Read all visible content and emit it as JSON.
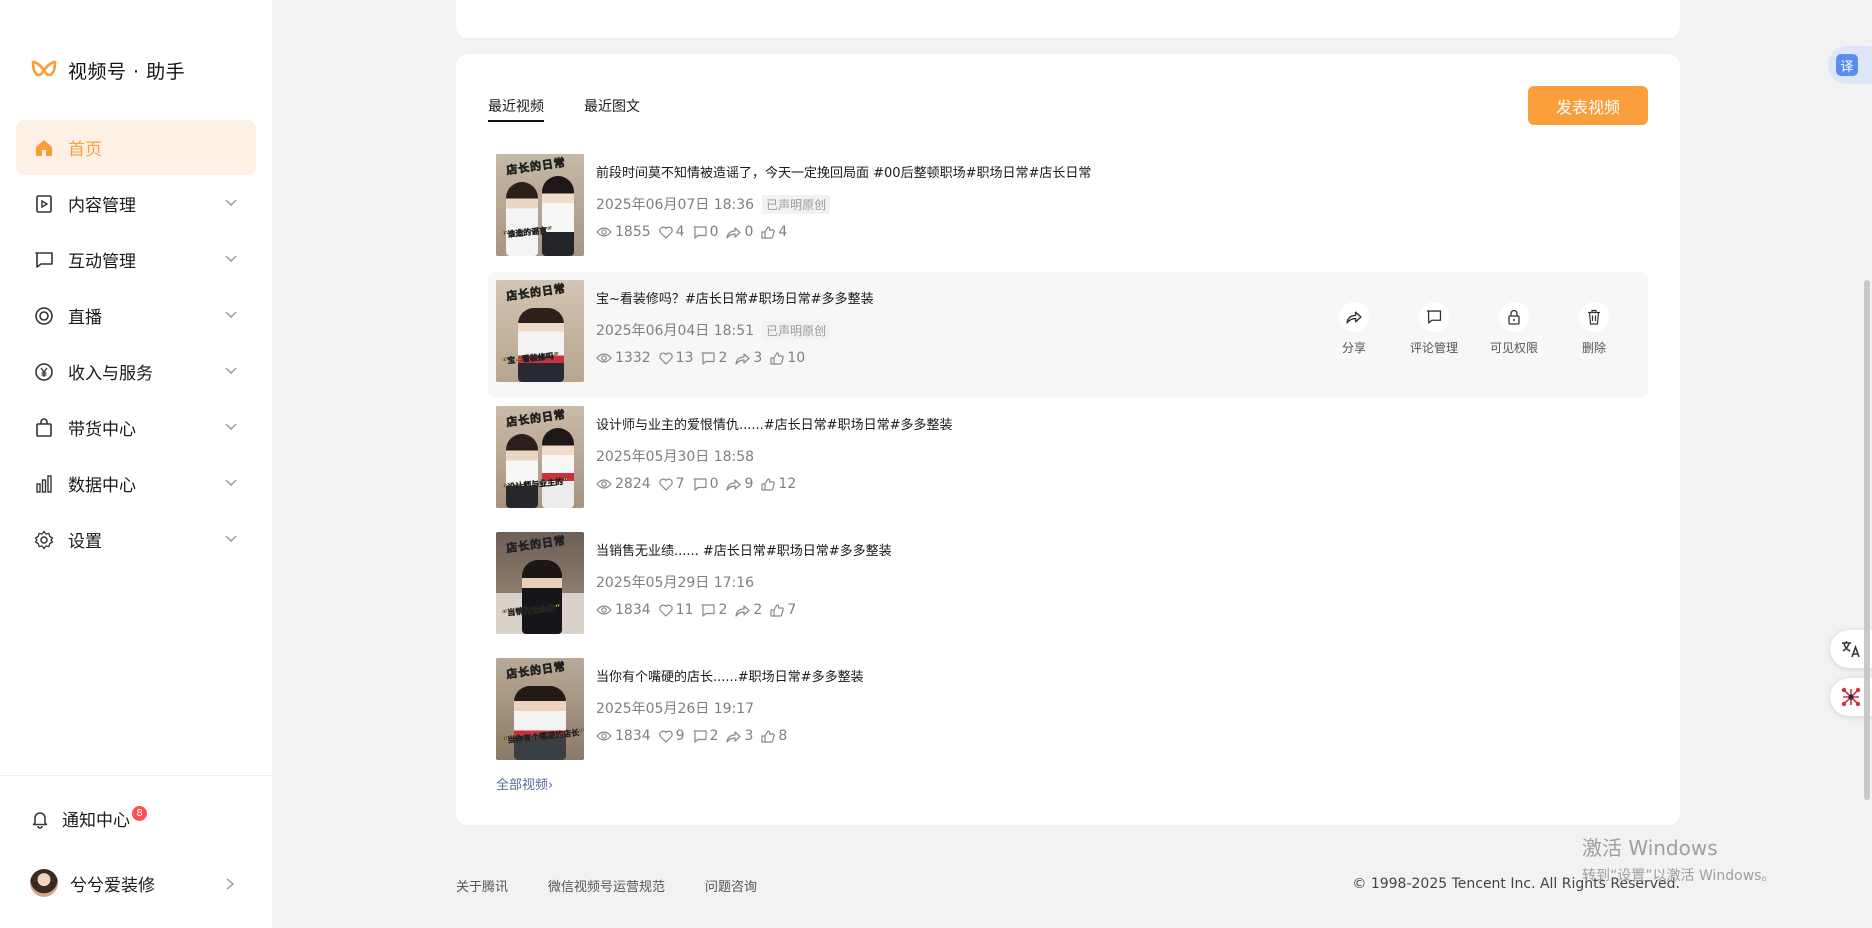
{
  "app": {
    "title": "视频号 · 助手"
  },
  "sidebar": {
    "items": [
      {
        "label": "首页",
        "icon": "home-icon",
        "active": true
      },
      {
        "label": "内容管理",
        "icon": "content-icon"
      },
      {
        "label": "互动管理",
        "icon": "comment-icon"
      },
      {
        "label": "直播",
        "icon": "live-icon"
      },
      {
        "label": "收入与服务",
        "icon": "yen-icon"
      },
      {
        "label": "带货中心",
        "icon": "bag-icon"
      },
      {
        "label": "数据中心",
        "icon": "chart-icon"
      },
      {
        "label": "设置",
        "icon": "gear-icon"
      }
    ],
    "notice": {
      "label": "通知中心",
      "badge": "8"
    },
    "user": {
      "name": "兮兮爱装修"
    }
  },
  "tabs": [
    {
      "label": "最近视频",
      "active": true
    },
    {
      "label": "最近图文"
    }
  ],
  "publish_button": "发表视频",
  "videos": [
    {
      "title": "前段时间莫不知情被造谣了，今天一定挽回局面 #00后整顿职场#职场日常#店长日常",
      "date": "2025年06月07日 18:36",
      "original_tag": "已声明原创",
      "views": "1855",
      "likes": "4",
      "comments": "0",
      "shares": "0",
      "thumbs": "4",
      "cap_top": "店长的日常",
      "cap_bot": "“谁造的谣言”"
    },
    {
      "title": "宝~看装修吗？#店长日常#职场日常#多多整装",
      "date": "2025年06月04日 18:51",
      "original_tag": "已声明原创",
      "views": "1332",
      "likes": "13",
      "comments": "2",
      "shares": "3",
      "thumbs": "10",
      "cap_top": "店长的日常",
      "cap_bot": "“宝~看装修吗”"
    },
    {
      "title": "设计师与业主的爱恨情仇......#店长日常#职场日常#多多整装",
      "date": "2025年05月30日 18:58",
      "views": "2824",
      "likes": "7",
      "comments": "0",
      "shares": "9",
      "thumbs": "12",
      "cap_top": "店长的日常",
      "cap_bot": "“设计师与业主的”"
    },
    {
      "title": "当销售无业绩...... #店长日常#职场日常#多多整装",
      "date": "2025年05月29日 17:16",
      "views": "1834",
      "likes": "11",
      "comments": "2",
      "shares": "2",
      "thumbs": "7",
      "cap_top": "店长的日常",
      "cap_bot": "“当销售无业绩”"
    },
    {
      "title": "当你有个嘴硬的店长......#职场日常#多多整装",
      "date": "2025年05月26日 19:17",
      "views": "1834",
      "likes": "9",
      "comments": "2",
      "shares": "3",
      "thumbs": "8",
      "cap_top": "店长的日常",
      "cap_bot": "“当你有个嘴硬的店长”"
    }
  ],
  "row_actions": [
    {
      "label": "分享",
      "icon": "share-icon"
    },
    {
      "label": "评论管理",
      "icon": "comment-icon"
    },
    {
      "label": "可见权限",
      "icon": "lock-icon"
    },
    {
      "label": "删除",
      "icon": "trash-icon"
    }
  ],
  "all_videos_link": "全部视频",
  "footer": {
    "links": [
      "关于腾讯",
      "微信视频号运营规范",
      "问题咨询"
    ],
    "copyright": "© 1998-2025 Tencent Inc. All Rights Reserved."
  },
  "translate_button": "译",
  "watermark": {
    "line1": "激活 Windows",
    "line2": "转到“设置”以激活 Windows。"
  },
  "colors": {
    "accent": "#fa9d3b",
    "link": "#576b95",
    "badge": "#fa5151"
  }
}
